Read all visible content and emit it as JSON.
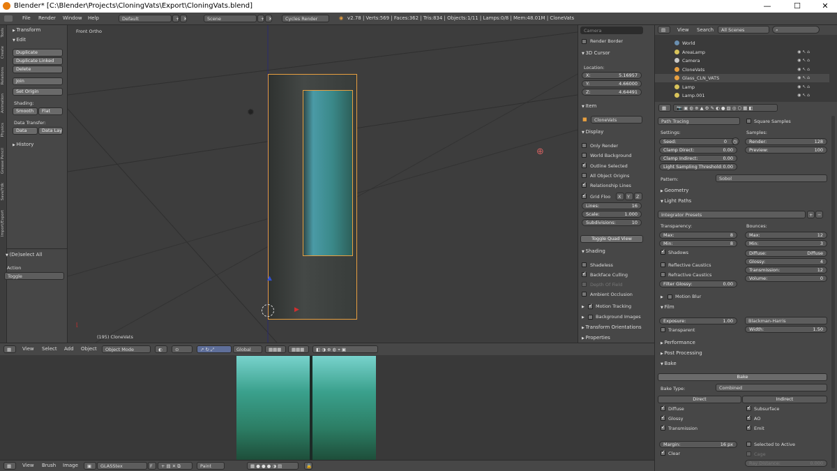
{
  "window": {
    "title": "Blender* [C:\\Blender\\Projects\\CloningVats\\Export\\CloningVats.blend]",
    "minimize": "—",
    "maximize": "☐",
    "close": "✕"
  },
  "menu": {
    "file": "File",
    "render": "Render",
    "window": "Window",
    "help": "Help",
    "layout": "Default",
    "scene": "Scene",
    "engine": "Cycles Render",
    "stats": "v2.78 | Verts:569 | Faces:362 | Tris:834 | Objects:1/11 | Lamps:0/8 | Mem:48.01M | CloneVats"
  },
  "tools": {
    "tabs": [
      "Tools",
      "Create",
      "Relations",
      "Animation",
      "Physics",
      "Grease Pencil",
      "Save/Ydk",
      "Import/Export"
    ],
    "transform": "Transform",
    "edit": "Edit",
    "duplicate": "Duplicate",
    "duplicate_linked": "Duplicate Linked",
    "delete": "Delete",
    "join": "Join",
    "set_origin": "Set Origin",
    "shading": "Shading:",
    "smooth": "Smooth",
    "flat": "Flat",
    "data_transfer": "Data Transfer:",
    "data": "Data",
    "data_lay": "Data Lay",
    "history": "History",
    "op_title": "(De)select All",
    "action": "Action",
    "action_value": "Toggle"
  },
  "viewport": {
    "view_name": "Front Ortho",
    "object_label": "(195) CloneVats"
  },
  "npanel": {
    "camera": "Camera",
    "render_border": "Render Border",
    "cursor": "3D Cursor",
    "location": "Location:",
    "x_label": "X:",
    "x": "5.16957",
    "y_label": "Y:",
    "y": "4.66000",
    "z_label": "Z:",
    "z": "4.64491",
    "item": "Item",
    "item_name": "CloneVats",
    "display": "Display",
    "only_render": "Only Render",
    "world_background": "World Background",
    "outline_selected": "Outline Selected",
    "all_object_origins": "All Object Origins",
    "relationship_lines": "Relationship Lines",
    "grid_floor": "Grid Floo",
    "ax_x": "X",
    "ax_y": "Y",
    "ax_z": "Z",
    "lines_label": "Lines:",
    "lines": "16",
    "scale_label": "Scale:",
    "scale": "1.000",
    "subdiv_label": "Subdivisions:",
    "subdiv": "10",
    "toggle_quad": "Toggle Quad View",
    "shading": "Shading",
    "shadeless": "Shadeless",
    "backface": "Backface Culling",
    "dof": "Depth Of Field",
    "ao": "Ambient Occlusion",
    "motion_tracking": "Motion Tracking",
    "background_images": "Background Images",
    "transform_orient": "Transform Orientations",
    "properties": "Properties"
  },
  "vp_header": {
    "view": "View",
    "select": "Select",
    "add": "Add",
    "object": "Object",
    "mode": "Object Mode",
    "orientation": "Global"
  },
  "img_header": {
    "view": "View",
    "brush": "Brush",
    "image": "Image",
    "image_name": "GLASStex",
    "f": "F",
    "mode": "Paint"
  },
  "outliner": {
    "view": "View",
    "search": "Search",
    "scenes": "All Scenes",
    "items": [
      {
        "name": "World",
        "color": "#6a8fb0"
      },
      {
        "name": "AreaLamp",
        "color": "#d8c35a"
      },
      {
        "name": "Camera",
        "color": "#c9c9c9"
      },
      {
        "name": "CloneVats",
        "color": "#e8a040"
      },
      {
        "name": "Glass_CLN_VATS",
        "color": "#e8a040"
      },
      {
        "name": "Lamp",
        "color": "#d8c35a"
      },
      {
        "name": "Lamp.001",
        "color": "#d8c35a"
      }
    ]
  },
  "props": {
    "integrator": "Path Tracing",
    "square_samples": "Square Samples",
    "settings": "Settings:",
    "samples": "Samples:",
    "seed_l": "Seed:",
    "seed": "0",
    "render_l": "Render:",
    "render": "128",
    "clamp_direct_l": "Clamp Direct:",
    "clamp_direct": "0.00",
    "preview_l": "Preview:",
    "preview": "100",
    "clamp_indirect_l": "Clamp Indirect:",
    "clamp_indirect": "0.00",
    "light_thresh_l": "Light Sampling Threshold:",
    "light_thresh": "0.00",
    "pattern_l": "Pattern:",
    "pattern": "Sobol",
    "geometry": "Geometry",
    "light_paths": "Light Paths",
    "integrator_presets": "Integrator Presets",
    "transparency": "Transparency:",
    "bounces": "Bounces:",
    "t_max_l": "Max:",
    "t_max": "8",
    "t_min_l": "Min:",
    "t_min": "8",
    "b_max_l": "Max:",
    "b_max": "12",
    "b_min_l": "Min:",
    "b_min": "3",
    "shadows": "Shadows",
    "diffuse_l": "Diffuse:",
    "diffuse": "Diffuse",
    "glossy_l": "Glossy:",
    "glossy": "4",
    "refl_caustics": "Reflective Caustics",
    "transmission_l": "Transmission:",
    "transmission": "12",
    "refr_caustics": "Refractive Caustics",
    "volume_l": "Volume:",
    "volume": "0",
    "filter_glossy_l": "Filter Glossy:",
    "filter_glossy": "0.00",
    "motion_blur": "Motion Blur",
    "film": "Film",
    "exposure_l": "Exposure:",
    "exposure": "1.00",
    "filter": "Blackman-Harris",
    "transparent": "Transparent",
    "width_l": "Width:",
    "width": "1.50",
    "performance": "Performance",
    "post_processing": "Post Processing",
    "bake": "Bake",
    "bake_btn": "Bake",
    "bake_type_l": "Bake Type:",
    "bake_type": "Combined",
    "direct": "Direct",
    "indirect": "Indirect",
    "subsurface": "Subsurface",
    "glossy_cb": "Glossy",
    "ao_cb": "AO",
    "transmission_cb": "Transmission",
    "emit": "Emit",
    "margin_l": "Margin:",
    "margin": "16 px",
    "selected_to_active": "Selected to Active",
    "clear": "Clear",
    "cage": "Cage",
    "ray_distance_l": "Ray Distance:",
    "ray_distance": "0.000"
  }
}
